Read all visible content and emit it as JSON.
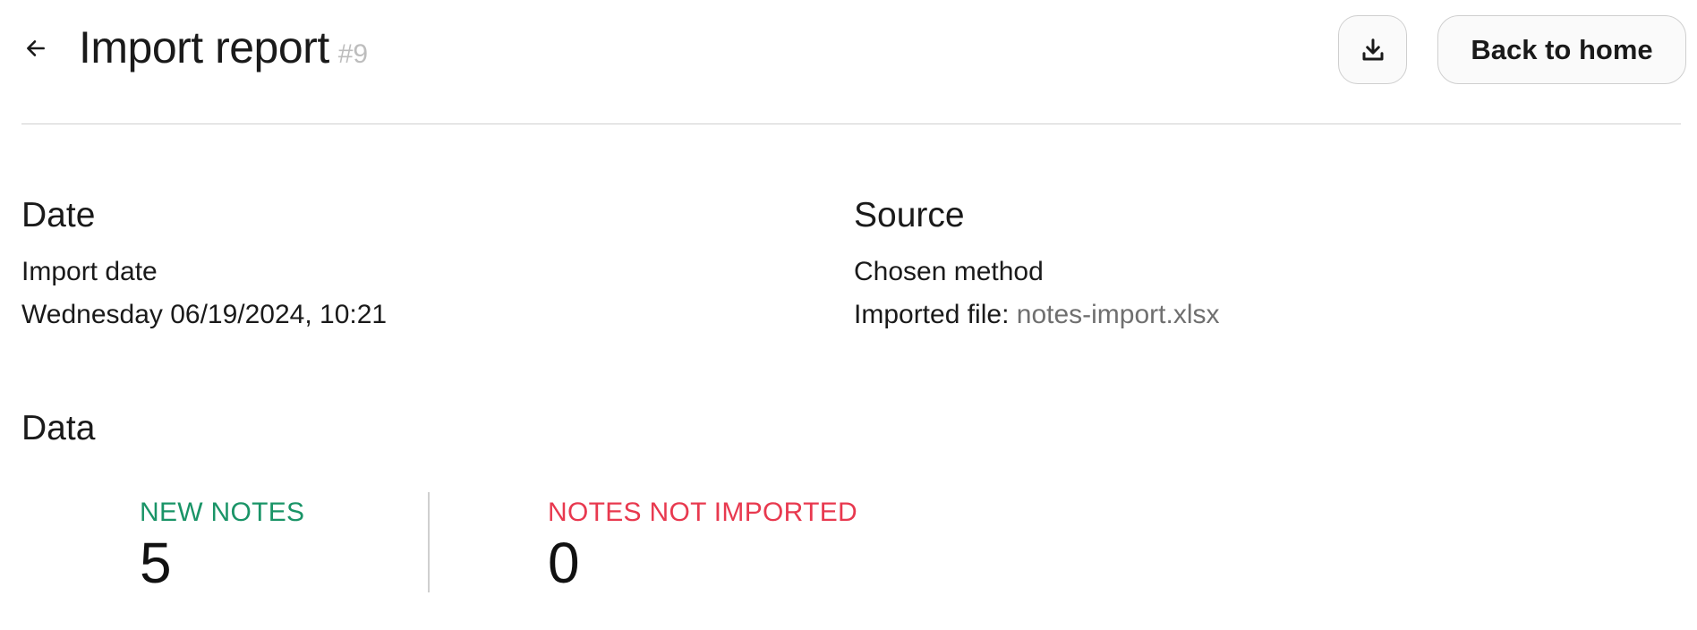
{
  "header": {
    "title": "Import report",
    "report_id": "#9",
    "back_icon": "arrow-left-icon",
    "download_icon": "download-icon",
    "home_button_label": "Back to home"
  },
  "date_section": {
    "title": "Date",
    "label": "Import date",
    "value": "Wednesday 06/19/2024, 10:21"
  },
  "source_section": {
    "title": "Source",
    "label": "Chosen method",
    "file_prefix": "Imported file:",
    "file_name": "notes-import.xlsx"
  },
  "data_section": {
    "title": "Data",
    "stats": [
      {
        "label": "NEW NOTES",
        "value": "5",
        "color": "#1a9467"
      },
      {
        "label": "NOTES NOT IMPORTED",
        "value": "0",
        "color": "#e8394f"
      }
    ]
  },
  "colors": {
    "text": "#1a1a1a",
    "muted": "#bdbdbd",
    "border": "#cfcfcf",
    "success": "#1a9467",
    "danger": "#e8394f"
  }
}
